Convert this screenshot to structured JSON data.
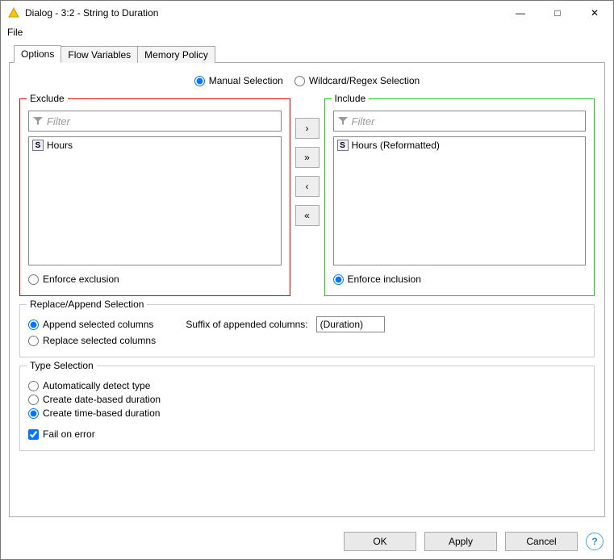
{
  "window": {
    "title": "Dialog - 3:2 - String to Duration",
    "menu_file": "File",
    "controls": {
      "min": "—",
      "max": "□",
      "close": "✕"
    }
  },
  "tabs": {
    "options": "Options",
    "flow_variables": "Flow Variables",
    "memory_policy": "Memory Policy"
  },
  "selection_mode": {
    "manual": "Manual Selection",
    "wildcard": "Wildcard/Regex Selection"
  },
  "exclude": {
    "legend": "Exclude",
    "filter_placeholder": "Filter",
    "items": [
      {
        "type": "S",
        "label": "Hours"
      }
    ],
    "enforce": "Enforce exclusion"
  },
  "include": {
    "legend": "Include",
    "filter_placeholder": "Filter",
    "items": [
      {
        "type": "S",
        "label": "Hours (Reformatted)"
      }
    ],
    "enforce": "Enforce inclusion"
  },
  "move": {
    "right": "›",
    "all_right": "»",
    "left": "‹",
    "all_left": "«"
  },
  "replace": {
    "legend": "Replace/Append Selection",
    "append": "Append selected columns",
    "suffix_label": "Suffix of appended columns:",
    "suffix_value": "(Duration)",
    "replace": "Replace selected columns"
  },
  "type_selection": {
    "legend": "Type Selection",
    "auto": "Automatically detect type",
    "date_based": "Create date-based duration",
    "time_based": "Create time-based duration",
    "fail": "Fail on error"
  },
  "buttons": {
    "ok": "OK",
    "apply": "Apply",
    "cancel": "Cancel",
    "help": "?"
  }
}
